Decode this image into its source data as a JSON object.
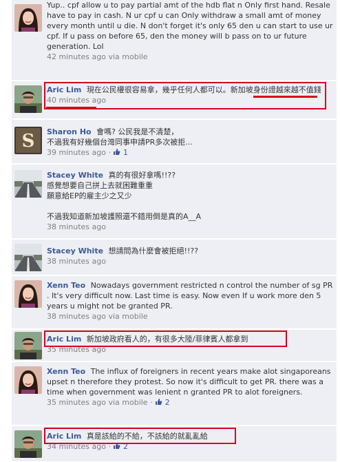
{
  "comments": [
    {
      "author": "Xenn Teo",
      "text": "Yup.. cpf allow u to pay partial amt of the hdb flat n Only first hand. Resale have to pay in cash. N ur cpf u can Only withdraw a small amt of money every month until u die. N don't forget it's only 65 den u can start to use ur cpf. If u pass on before 65, den the money will b pass on to ur future generation. Lol",
      "time": "42 minutes ago via mobile",
      "avatar_icon": "woman-portrait-icon"
    },
    {
      "author": "Aric Lim",
      "text_a": "現在公民權很容易拿，幾乎任何人都可以。",
      "text_b": "新加坡身份證越來越不值錢",
      "time": "40 minutes ago",
      "avatar_icon": "man-portrait-icon"
    },
    {
      "author": "Sharon Ho",
      "text": "會嗎? 公民我是不清楚，\n不過我有好幾個台灣同事申請PR多次被拒...",
      "time": "39 minutes ago",
      "likes": "1",
      "avatar_icon": "letter-s-icon"
    },
    {
      "author": "Stacey White",
      "text": "真的有很好拿嗎!!??\n感覺想要自己拼上去就困難重重\n願意給EP的雇主少之又少\n\n不過我知道新加坡護照還不錯用倒是真的A__A",
      "time": "38 minutes ago",
      "avatar_icon": "road-photo-icon"
    },
    {
      "author": "Stacey White",
      "text": "想請問為什麼會被拒絕!!??",
      "time": "38 minutes ago",
      "avatar_icon": "road-photo-icon"
    },
    {
      "author": "Xenn Teo",
      "text": "Nowadays government restricted n control the number of sg PR . It's very difficult now. Last time is easy. Now even If u work more den 5 years u might not be granted PR.",
      "time": "38 minutes ago via mobile",
      "avatar_icon": "woman-portrait-icon"
    },
    {
      "author": "Aric Lim",
      "text": "新加坡政府看人的，有很多大陸/菲律賓人都拿到",
      "time": "35 minutes ago",
      "avatar_icon": "man-portrait-icon"
    },
    {
      "author": "Xenn Teo",
      "text": "The influx of foreigners in recent years make alot singaporeans upset n therefore they protest. So now it's difficult to get PR. there was a time when government was lenient n granted PR to alot foreigners.",
      "time": "35 minutes ago via mobile",
      "likes": "2",
      "avatar_icon": "woman-portrait-icon"
    },
    {
      "author": "Aric Lim",
      "text": "真是該給的不給，不該給的就亂亂給",
      "time": "34 minutes ago",
      "likes": "2",
      "avatar_icon": "man-portrait-icon"
    }
  ],
  "ui": {
    "separator": " · ",
    "like_icon": "thumbs-up-icon",
    "highlight_color": "#d8001d",
    "link_color": "#3b5998"
  }
}
